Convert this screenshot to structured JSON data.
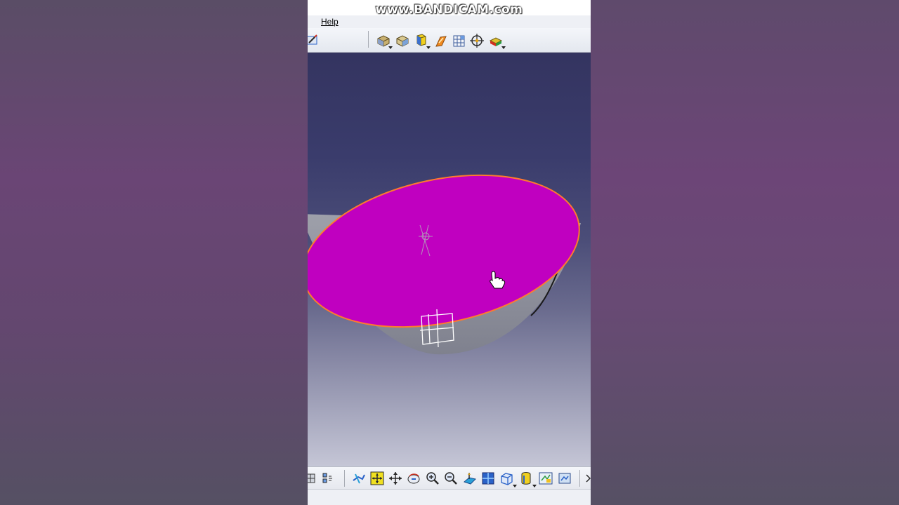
{
  "watermark": "www.BANDICAM.com",
  "menu": {
    "help_label": "Help"
  },
  "toolbar_top": {
    "icons": [
      "sketcher-icon",
      "pad-icon",
      "pocket-icon",
      "cylinder-icon",
      "part-body-icon",
      "grid-icon",
      "snap-icon",
      "material-icon"
    ]
  },
  "viewport": {
    "background_top": "#343460",
    "background_bottom": "#c5c6d6",
    "cap_face_color": "#c000c0",
    "cap_edge_color": "#ff7a2e",
    "shell_color": "#8e919c"
  },
  "toolbar_bottom": {
    "icons": [
      "select-icon",
      "fly-mode-icon",
      "fit-all-icon",
      "pan-icon",
      "rotate-icon",
      "zoom-in-icon",
      "zoom-out-icon",
      "normal-view-icon",
      "multi-view-icon",
      "iso-view-icon",
      "shading-icon",
      "hide-show-icon",
      "swap-space-icon"
    ]
  },
  "colors": {
    "accent_blue": "#2a62c8",
    "accent_yellow": "#f0c020"
  }
}
